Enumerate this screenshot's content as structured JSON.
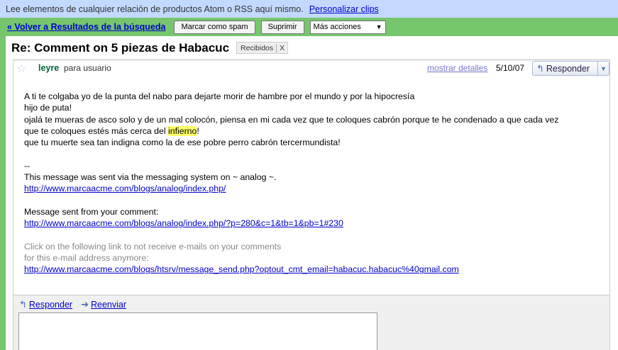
{
  "topbar": {
    "text": "Lee elementos de cualquier relación de productos Atom o RSS aquí mismo.",
    "link": "Personalizar clips"
  },
  "actionbar": {
    "back": "« Volver a Resultados de la búsqueda",
    "spam": "Marcar como spam",
    "delete": "Suprimir",
    "more": "Más acciones",
    "more_arrow": "▼"
  },
  "subject": {
    "title": "Re: Comment on 5 piezas de Habacuc",
    "label": "Recibidos",
    "label_x": "X"
  },
  "message": {
    "sender": "leyre",
    "recipient": "para usuario",
    "details": "mostrar detalles",
    "date": "5/10/07",
    "reply": "Responder",
    "reply_arrow": "▼",
    "lines": {
      "l1": "A ti te colgaba yo de la punta del nabo para dejarte morir de hambre por el mundo y por la hipocresía",
      "l2": "hijo de puta!",
      "l3": "ojalá te mueras de asco solo y de un mal colocón, piensa en mi cada vez que te coloques cabrón porque te he condenado a que cada vez",
      "l4a": "que te coloques estés más cerca del ",
      "l4hl": "infierno",
      "l4b": "!",
      "l5": "que tu muerte sea tan indigna como la de ese pobre perro cabrón tercermundista!",
      "sig": "--",
      "sent_via": "This message was sent via the messaging system on ~ analog ~.",
      "url1": "http://www.marcaacme.com/blogs/analog/index.php/",
      "sent_from": "Message sent from your comment:",
      "url2": "http://www.marcaacme.com/blogs/analog/index.php/?p=280&c=1&tb=1&pb=1#230",
      "unsub1": "Click on the following link to not receive e-mails on your comments",
      "unsub2": "for this e-mail address anymore:",
      "url3": "http://www.marcaacme.com/blogs/htsrv/message_send.php?optout_cmt_email=habacuc.habacuc%40gmail.com"
    }
  },
  "footer": {
    "reply": "Responder",
    "forward": "Reenviar"
  },
  "colors": {
    "topbar": "#c3d9ff",
    "actionbar": "#76c66e",
    "link": "#0000cc",
    "sender": "#006633",
    "highlight": "#ffff66"
  }
}
